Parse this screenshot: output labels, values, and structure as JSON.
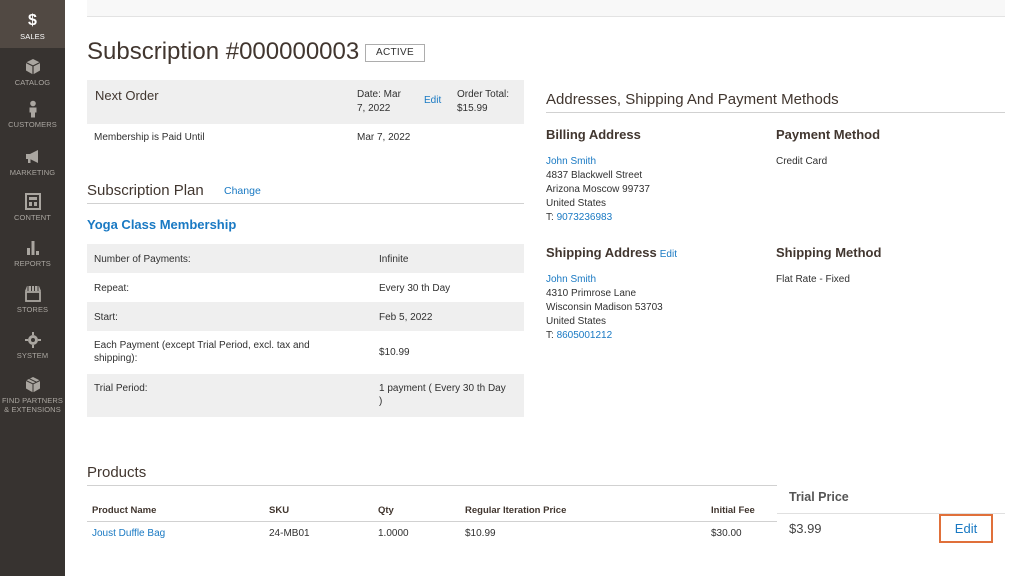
{
  "sidebar": {
    "items": [
      {
        "label": "SALES",
        "icon": "dollar-icon"
      },
      {
        "label": "CATALOG",
        "icon": "cube-icon"
      },
      {
        "label": "CUSTOMERS",
        "icon": "person-icon"
      },
      {
        "label": "MARKETING",
        "icon": "megaphone-icon"
      },
      {
        "label": "CONTENT",
        "icon": "layout-icon"
      },
      {
        "label": "REPORTS",
        "icon": "bar-chart-icon"
      },
      {
        "label": "STORES",
        "icon": "store-icon"
      },
      {
        "label": "SYSTEM",
        "icon": "gear-icon"
      },
      {
        "label_line1": "FIND PARTNERS",
        "label_line2": "& EXTENSIONS",
        "icon": "box-icon"
      }
    ]
  },
  "page": {
    "title": "Subscription #000000003",
    "status": "ACTIVE"
  },
  "next_order": {
    "title": "Next Order",
    "date_line1": "Date: Mar",
    "date_line2": "7, 2022",
    "edit": "Edit",
    "total_line1": "Order Total:",
    "total_line2": "$15.99",
    "paid_label": "Membership is Paid Until",
    "paid_value": "Mar 7, 2022"
  },
  "plan": {
    "heading": "Subscription Plan",
    "change": "Change",
    "name": "Yoga Class Membership",
    "rows": [
      {
        "k": "Number of Payments:",
        "v": "Infinite"
      },
      {
        "k": "Repeat:",
        "v": "Every 30 th Day"
      },
      {
        "k": "Start:",
        "v": "Feb 5, 2022"
      },
      {
        "k1": "Each Payment (except Trial Period, excl. tax and",
        "k2": "shipping):",
        "v": "$10.99"
      },
      {
        "k": "Trial Period:",
        "v1": "1 payment ( Every 30 th Day",
        "v2": ")"
      }
    ]
  },
  "addresses": {
    "heading": "Addresses, Shipping And Payment Methods",
    "billing": {
      "title": "Billing Address",
      "name": "John Smith",
      "street": "4837 Blackwell Street",
      "city": "Arizona  Moscow  99737",
      "country": "United States",
      "phone_prefix": "T: ",
      "phone": "9073236983"
    },
    "payment": {
      "title": "Payment Method",
      "value": "Credit Card"
    },
    "shipping": {
      "title": "Shipping Address",
      "edit": "Edit",
      "name": "John Smith",
      "street": "4310 Primrose Lane",
      "city": "Wisconsin  Madison  53703",
      "country": "United States",
      "phone_prefix": "T: ",
      "phone": "8605001212"
    },
    "shipping_method": {
      "title": "Shipping Method",
      "value": "Flat Rate - Fixed"
    }
  },
  "products": {
    "heading": "Products",
    "columns": [
      "Product Name",
      "SKU",
      "Qty",
      "Regular Iteration Price",
      "Initial Fee"
    ],
    "rows": [
      {
        "name": "Joust Duffle Bag",
        "sku": "24-MB01",
        "qty": "1.0000",
        "price": "$10.99",
        "fee": "$30.00"
      }
    ]
  },
  "callout": {
    "header": "Trial Price",
    "value": "$3.99",
    "edit": "Edit",
    "highlight_color": "#e0703a"
  },
  "colors": {
    "sidebar": "#373330",
    "link": "#1979c3",
    "row_stripe": "#efefef"
  }
}
